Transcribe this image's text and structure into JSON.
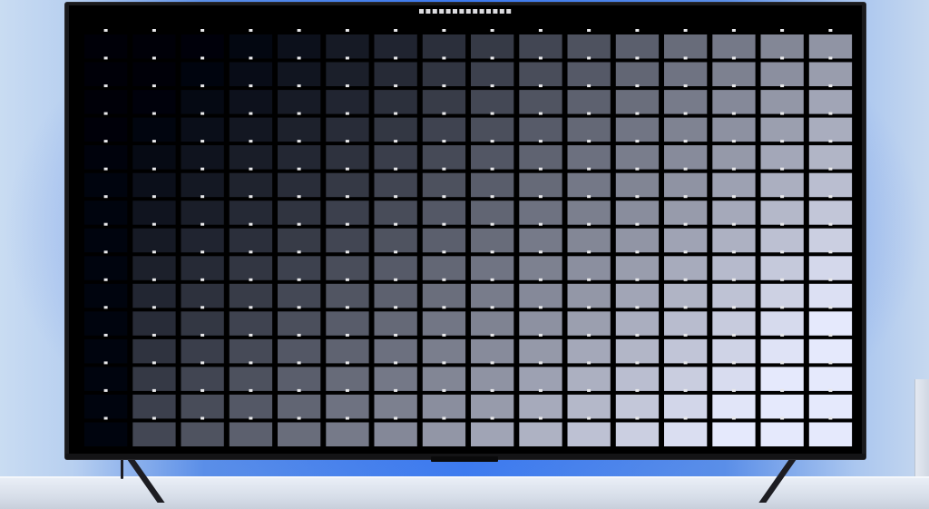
{
  "scene": {
    "description_free": true,
    "components": [
      "wall",
      "shelf",
      "television",
      "screen",
      "test-pattern-grid"
    ]
  },
  "test_pattern": {
    "columns": 16,
    "rows": 15,
    "visible_labels_legible": false,
    "max_gray_level": 235
  },
  "colors": {
    "wall_blue": "#3f7ef0",
    "wall_light": "#c9dcf2",
    "tv_bezel": "#1a1a1c",
    "screen_black": "#000000",
    "shelf": "#dde3ec"
  }
}
